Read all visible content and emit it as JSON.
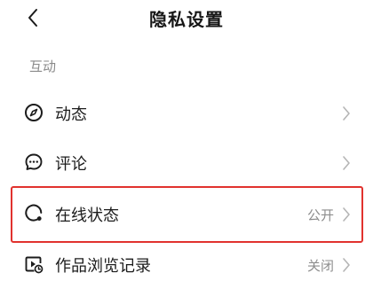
{
  "header": {
    "title": "隐私设置"
  },
  "sections": [
    {
      "label": "互动",
      "items": [
        {
          "label": "动态",
          "value": "",
          "icon": "compass-icon"
        },
        {
          "label": "评论",
          "value": "",
          "icon": "comment-icon"
        },
        {
          "label": "在线状态",
          "value": "公开",
          "icon": "online-status-icon"
        },
        {
          "label": "作品浏览记录",
          "value": "关闭",
          "icon": "video-history-icon"
        }
      ]
    }
  ],
  "colors": {
    "highlight_border": "#e1322e",
    "secondary_text": "#8a8a8a"
  }
}
